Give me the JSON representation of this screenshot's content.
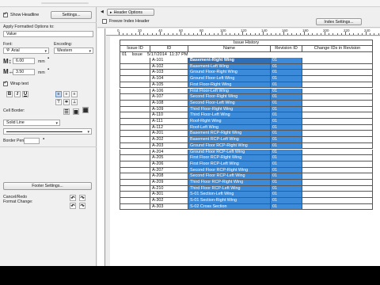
{
  "left_panel": {
    "show_headline_label": "Show Headline",
    "settings_button": "Settings...",
    "apply_formatted_options_label": "Apply Formatted Options to:",
    "apply_target_value": "Value",
    "font_label": "Font:",
    "encoding_label": "Encoding:",
    "font_value": "Arial",
    "encoding_value": "Western",
    "height_value": "6.00",
    "height_unit": "mm",
    "width_value": "3.50",
    "width_unit": "mm",
    "wrap_text_label": "Wrap text",
    "bold_glyph": "B",
    "italic_glyph": "I",
    "underline_glyph": "U",
    "cell_border_label": "Cell Border:",
    "cell_border_value": "Solid Line",
    "border_pen_label": "Border Pen:",
    "footer_settings_button": "Footer Settings...",
    "cancel_redo_label": "Cancel/Redo",
    "format_change_label": "Format Change:"
  },
  "right_toolbar": {
    "header_options_label": "Header Options",
    "freeze_index_header_label": "Freeze Index Header",
    "index_settings_button": "Index Settings..."
  },
  "ruler_numbers": [
    "0",
    "20",
    "40",
    "60",
    "80",
    "100",
    "120",
    "140",
    "160",
    "180",
    "200",
    "220",
    "240"
  ],
  "schedule": {
    "title": "Issue History",
    "columns": [
      "Issue ID",
      "ID",
      "Name",
      "Revision ID",
      "Change IDs in Revision"
    ],
    "issue_line": "01    Issue    5/17/2014  11:37 PM",
    "rows": [
      {
        "id": "A-101",
        "name": "Basement-Right Wing",
        "rev": "01"
      },
      {
        "id": "A-102",
        "name": "Basement-Left Wing",
        "rev": "01"
      },
      {
        "id": "A-103",
        "name": "Ground Floor-Right Wing",
        "rev": "01"
      },
      {
        "id": "A-104",
        "name": "Ground Floor-Left Wing",
        "rev": "01"
      },
      {
        "id": "A-105",
        "name": "First Floor-Right Wing",
        "rev": "01"
      },
      {
        "id": "A-106",
        "name": "First Floor-Left Wing",
        "rev": "01"
      },
      {
        "id": "A-107",
        "name": "Second Floor-Right Wing",
        "rev": "01"
      },
      {
        "id": "A-108",
        "name": "Second Floor-Left Wing",
        "rev": "01"
      },
      {
        "id": "A-109",
        "name": "Third Floor-Right Wing",
        "rev": "01"
      },
      {
        "id": "A-110",
        "name": "Third Floor-Left Wing",
        "rev": "01"
      },
      {
        "id": "A-111",
        "name": "Roof-Right Wing",
        "rev": "01"
      },
      {
        "id": "A-112",
        "name": "Roof-Left Wing",
        "rev": "01"
      },
      {
        "id": "A-201",
        "name": "Basement RCP-Right Wing",
        "rev": "01"
      },
      {
        "id": "A-202",
        "name": "Basement RCP-Left Wing",
        "rev": "01"
      },
      {
        "id": "A-203",
        "name": "Ground Floor RCP-Right Wing",
        "rev": "01"
      },
      {
        "id": "A-204",
        "name": "Ground Floor RCP-Left Wing",
        "rev": "01"
      },
      {
        "id": "A-205",
        "name": "First Floor RCP-Right Wing",
        "rev": "01"
      },
      {
        "id": "A-206",
        "name": "First Floor RCP-Left Wing",
        "rev": "01"
      },
      {
        "id": "A-207",
        "name": "Second Floor RCP-Right Wing",
        "rev": "01"
      },
      {
        "id": "A-208",
        "name": "Second Floor RCP-Left Wing",
        "rev": "01"
      },
      {
        "id": "A-209",
        "name": "Third Floor RCP-Right Wing",
        "rev": "01"
      },
      {
        "id": "A-210",
        "name": "Third Floor RCP-Left Wing",
        "rev": "01"
      },
      {
        "id": "A-301",
        "name": "S-01 Section-Left Wing",
        "rev": "01"
      },
      {
        "id": "A-302",
        "name": "S-01 Section-Right Wing",
        "rev": "01"
      },
      {
        "id": "A-303",
        "name": "S-02 Cross Section",
        "rev": "01"
      }
    ]
  },
  "colors": {
    "selection": "#3b8bda",
    "panel": "#f0f0f0"
  }
}
